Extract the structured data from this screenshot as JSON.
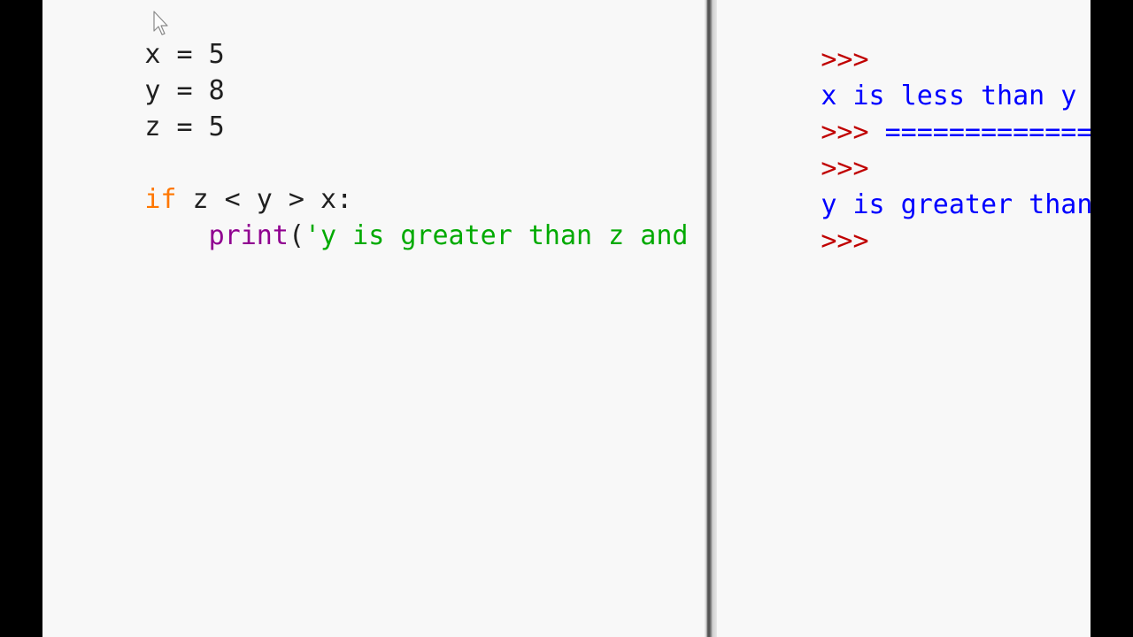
{
  "editor": {
    "lines": [
      {
        "code": "x = 5"
      },
      {
        "code": "y = 8"
      },
      {
        "code": "z = 5"
      },
      {
        "code": ""
      },
      {
        "keyword": "if",
        "rest": " z < y > x:"
      },
      {
        "indent": "    ",
        "builtin": "print",
        "paren": "(",
        "string": "'y is greater than z and"
      }
    ]
  },
  "shell": {
    "lines": [
      {
        "prompt": ">>>",
        "output": ""
      },
      {
        "prompt": "",
        "output": "x is less than y"
      },
      {
        "prompt": ">>> ",
        "output": "================="
      },
      {
        "prompt": ">>>",
        "output": ""
      },
      {
        "prompt": "",
        "output": "y is greater than z"
      },
      {
        "prompt": ">>>",
        "output": ""
      }
    ]
  },
  "colors": {
    "keyword": "#ff7700",
    "builtin": "#900090",
    "string": "#00aa00",
    "prompt": "#c00000",
    "output": "#0000ff",
    "background": "#f8f8f8"
  },
  "icons": {
    "cursor": "mouse-pointer-icon"
  }
}
